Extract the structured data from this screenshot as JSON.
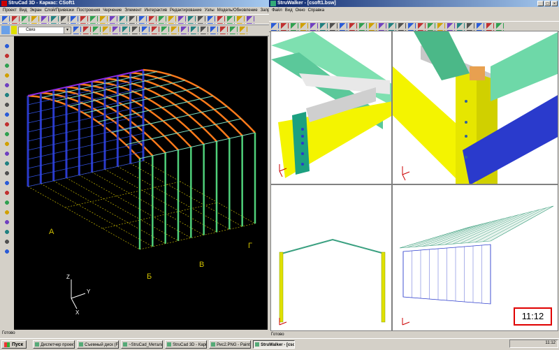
{
  "strucad": {
    "title": "StruCad 3D - Каркас: CSoft1",
    "menu": [
      "Проект",
      "Вид",
      "Экран",
      "Слой/Привязки",
      "Построения",
      "Черчение",
      "Элемент",
      "Интерактив",
      "Редактирование",
      "Узлы",
      "Модель/Обновление",
      "Запрос",
      "Маро"
    ],
    "layer_combo": "Связ",
    "status": "Готово",
    "grid_labels": [
      "А",
      "Б",
      "В",
      "Г"
    ],
    "axes": {
      "z": "Z",
      "y": "Y",
      "x": "X"
    }
  },
  "struwalker": {
    "title": "StruWalker - [csoft1.bsw]",
    "menu": [
      "Файл",
      "Вид",
      "Окно",
      "Справка"
    ],
    "status": "Готово"
  },
  "taskbar": {
    "start": "Пуск",
    "tasks": [
      "Диспетчер проектов St...",
      "Съемный диск (F:)",
      "~StruCad_Металлокар...",
      "StruCad 3D - Каркас: C...",
      "Рис2.PNG - Paint",
      "StruWalker - [csoft1..."
    ],
    "clock": "11:12"
  },
  "callout_clock": "11:12",
  "colors": {
    "frame_orange": "#ff7a1a",
    "beam_green": "#7fe0c0",
    "column_blue": "#2a3acc",
    "brace_purple": "#8a2be2",
    "yellow": "#f0f000",
    "grid_yellow": "#e0d000"
  }
}
